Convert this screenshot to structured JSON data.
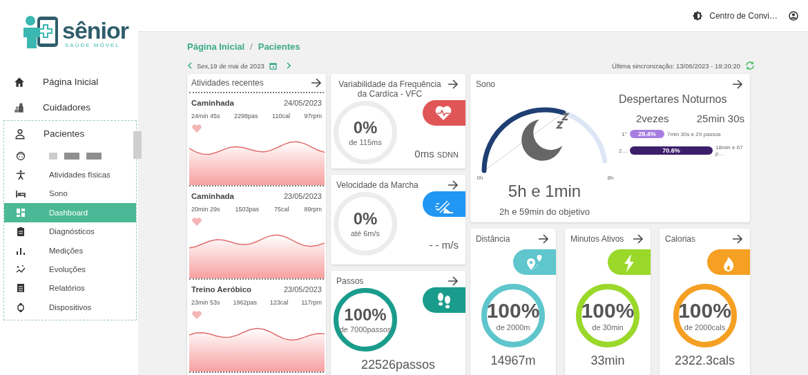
{
  "header": {
    "user_name": "Centro de Convi…"
  },
  "logo": {
    "name": "sênior",
    "tagline": "SAÚDE MÓVEL"
  },
  "sidebar": {
    "items": [
      {
        "label": "Página Inicial",
        "selected": false
      },
      {
        "label": "Cuidadores",
        "selected": false
      },
      {
        "label": "Pacientes",
        "selected": false,
        "expanded": true,
        "children": [
          {
            "kind": "redacted",
            "selected": false
          },
          {
            "kind": "link",
            "label": "Atividades físicas",
            "selected": false
          },
          {
            "kind": "link",
            "label": "Sono",
            "selected": false
          },
          {
            "kind": "link",
            "label": "Dashboard",
            "selected": true
          },
          {
            "kind": "link",
            "label": "Diagnósticos",
            "selected": false
          },
          {
            "kind": "link",
            "label": "Medições",
            "selected": false
          },
          {
            "kind": "link",
            "label": "Evoluções",
            "selected": false
          },
          {
            "kind": "link",
            "label": "Relatórios",
            "selected": false
          },
          {
            "kind": "link",
            "label": "Dispositivos",
            "selected": false
          }
        ]
      }
    ]
  },
  "breadcrumb": {
    "items": [
      "Página Inicial",
      "Pacientes"
    ],
    "separator": "/"
  },
  "date_nav": {
    "date": "Sex,19 de mai de 2023"
  },
  "sync": {
    "text": "Última sincronização: 13/06/2023 - 19:20:20"
  },
  "activities": {
    "title": "Atividades recentes",
    "items": [
      {
        "name": "Caminhada",
        "date": "24/05/2023",
        "duration": "24min 45s",
        "steps": "2298pas",
        "calories": "110cal",
        "heart_rate": "97rpm"
      },
      {
        "name": "Caminhada",
        "date": "23/05/2023",
        "duration": "20min 29s",
        "steps": "1503pas",
        "calories": "75cal",
        "heart_rate": "89rpm"
      },
      {
        "name": "Treino Aeróbico",
        "date": "23/05/2023",
        "duration": "23min 53s",
        "steps": "1962pas",
        "calories": "123cal",
        "heart_rate": "117rpm"
      }
    ]
  },
  "metrics": [
    {
      "kind": "side",
      "title": "Variabilidade da Frequência da Cardíca - VFC",
      "percent": "0%",
      "target": "de 115ms",
      "reading": "0ms",
      "unit": "SDNN",
      "color": "#e05555"
    },
    {
      "kind": "side",
      "title": "Velocidade da Marcha",
      "percent": "0%",
      "target": "até 6m/s",
      "reading": "- - m/s",
      "color": "#2196f3"
    },
    {
      "kind": "side-below",
      "title": "Passos",
      "percent": "100%",
      "target": "de 7000passos",
      "reading": "22526passos",
      "color": "#1a9c8c"
    }
  ],
  "sleep": {
    "title": "Sono",
    "scale_min": "0h",
    "scale_max": "8h",
    "duration": "5h e 1min",
    "goal_note": "2h e 59min do objetivo",
    "awakenings": {
      "title": "Despertares Noturnos",
      "count": "2vezes",
      "total": "25min 30s",
      "bars": [
        {
          "label": "1°",
          "percent": "29.4%",
          "detail": "7min 30s e 29 passos",
          "color": "#a77ee0"
        },
        {
          "label": "2…",
          "percent": "70.6%",
          "detail": "18min e 67 p…",
          "color": "#3b1f6b"
        }
      ]
    }
  },
  "goals": [
    {
      "kind": "stacked",
      "title": "Distância",
      "percent": "100%",
      "target": "de 2000m",
      "reading": "14967m",
      "color": "#5ec6cc"
    },
    {
      "kind": "stacked",
      "title": "Minutos Ativos",
      "percent": "100%",
      "target": "de 30min",
      "reading": "33min",
      "color": "#9ad82a"
    },
    {
      "kind": "stacked",
      "title": "Calorias",
      "percent": "100%",
      "target": "de 2000cals",
      "reading": "2322.3cals",
      "color": "#f5a023"
    }
  ]
}
